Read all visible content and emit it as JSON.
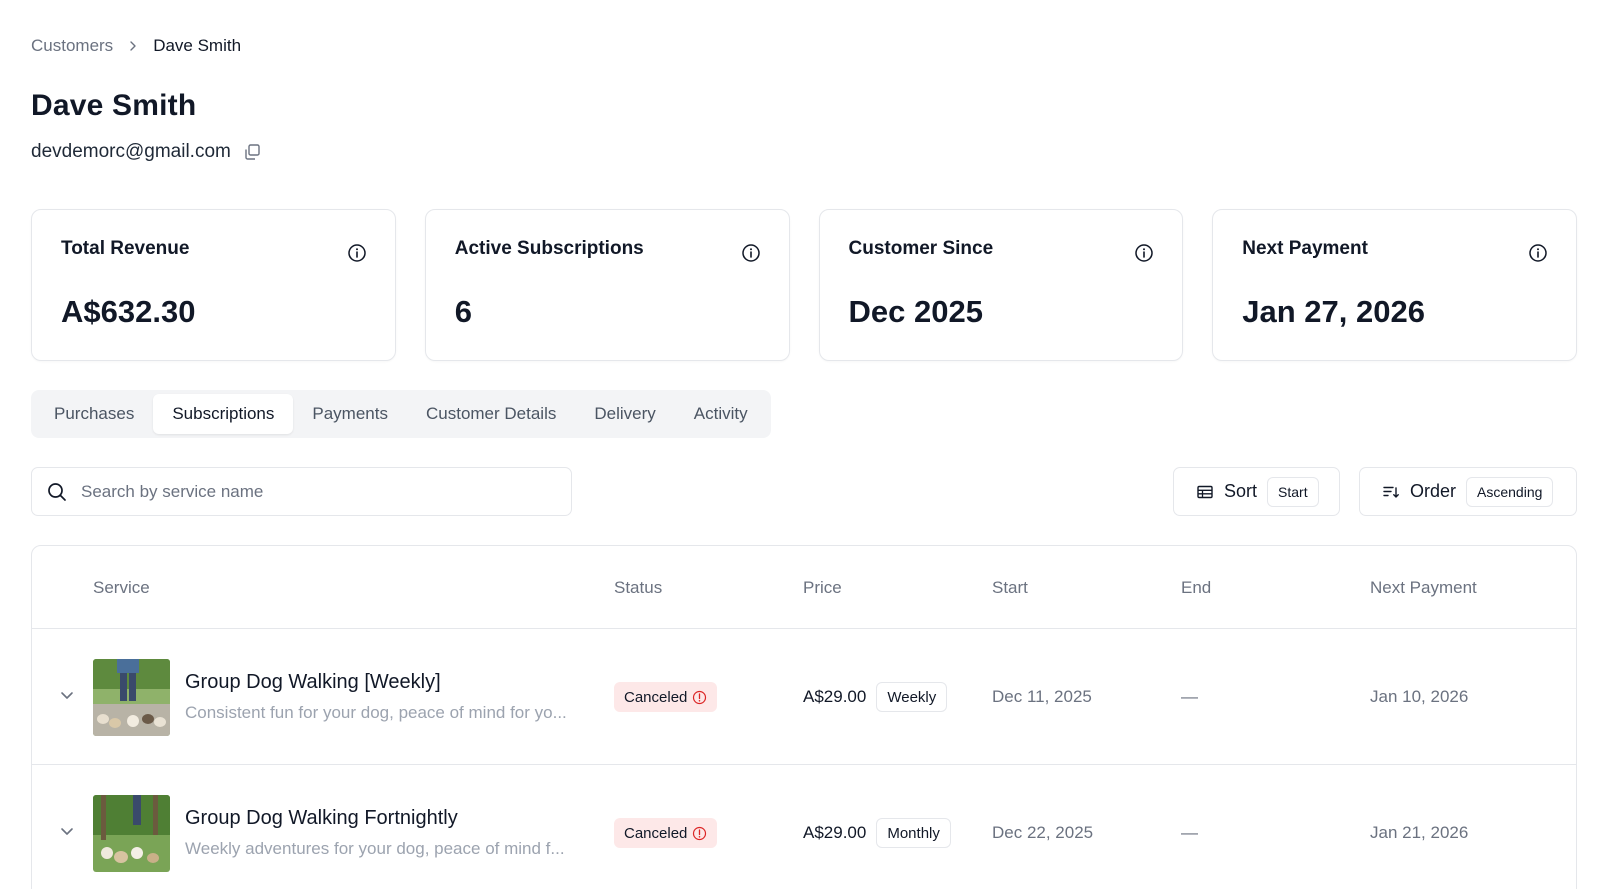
{
  "breadcrumb": {
    "parent": "Customers",
    "separator": "›",
    "current": "Dave Smith"
  },
  "customer": {
    "name": "Dave Smith",
    "email": "devdemorc@gmail.com"
  },
  "stats": [
    {
      "label": "Total Revenue",
      "value": "A$632.30",
      "icon": "info-icon"
    },
    {
      "label": "Active Subscriptions",
      "value": "6",
      "icon": "info-icon"
    },
    {
      "label": "Customer Since",
      "value": "Dec 2025",
      "icon": "info-icon"
    },
    {
      "label": "Next Payment",
      "value": "Jan 27, 2026",
      "icon": "info-icon"
    }
  ],
  "tabs": [
    {
      "label": "Purchases",
      "active": false
    },
    {
      "label": "Subscriptions",
      "active": true
    },
    {
      "label": "Payments",
      "active": false
    },
    {
      "label": "Customer Details",
      "active": false
    },
    {
      "label": "Delivery",
      "active": false
    },
    {
      "label": "Activity",
      "active": false
    }
  ],
  "search": {
    "placeholder": "Search by service name",
    "value": ""
  },
  "sort": {
    "label": "Sort",
    "value": "Start"
  },
  "order": {
    "label": "Order",
    "value": "Ascending"
  },
  "table": {
    "headers": [
      "Service",
      "Status",
      "Price",
      "Start",
      "End",
      "Next Payment"
    ],
    "rows": [
      {
        "name": "Group Dog Walking [Weekly]",
        "description": "Consistent fun for your dog, peace of mind for yo...",
        "status": "Canceled",
        "price": "A$29.00",
        "frequency": "Weekly",
        "start": "Dec 11, 2025",
        "end": "—",
        "next_payment": "Jan 10, 2026"
      },
      {
        "name": "Group Dog Walking Fortnightly",
        "description": "Weekly adventures for your dog, peace of mind f...",
        "status": "Canceled",
        "price": "A$29.00",
        "frequency": "Monthly",
        "start": "Dec 22, 2025",
        "end": "—",
        "next_payment": "Jan 21, 2026"
      }
    ]
  },
  "colors": {
    "text": "#111827",
    "muted": "#6b7280",
    "border": "#e5e7eb",
    "status_canceled_bg": "#fde8e8",
    "status_canceled_icon": "#dc2626"
  }
}
